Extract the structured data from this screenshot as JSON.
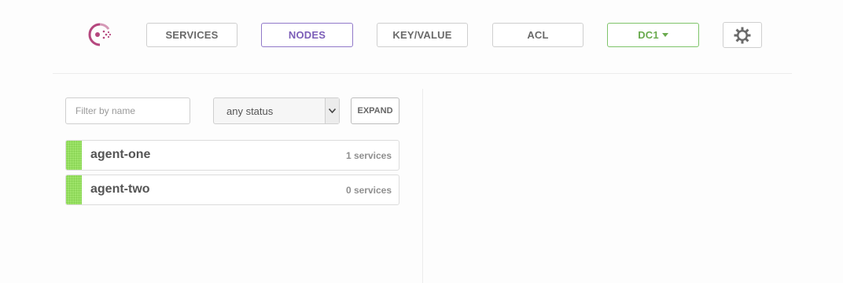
{
  "nav": {
    "services": "SERVICES",
    "nodes": "NODES",
    "keyvalue": "KEY/VALUE",
    "acl": "ACL",
    "datacenter": "DC1"
  },
  "filter": {
    "placeholder": "Filter by name",
    "status_value": "any status",
    "expand_label": "EXPAND"
  },
  "nodes": [
    {
      "name": "agent-one",
      "services": "1 services",
      "status": "passing"
    },
    {
      "name": "agent-two",
      "services": "0 services",
      "status": "passing"
    }
  ],
  "icons": {
    "logo": "consul-logo",
    "settings": "gear-icon",
    "dropdown": "caret-down-icon",
    "select_arrow": "chevron-down-icon"
  },
  "colors": {
    "active_nav": "#7c5eb8",
    "datacenter": "#6aaa4e",
    "status_passing": "#9ee46a",
    "logo": "#b5477e"
  }
}
